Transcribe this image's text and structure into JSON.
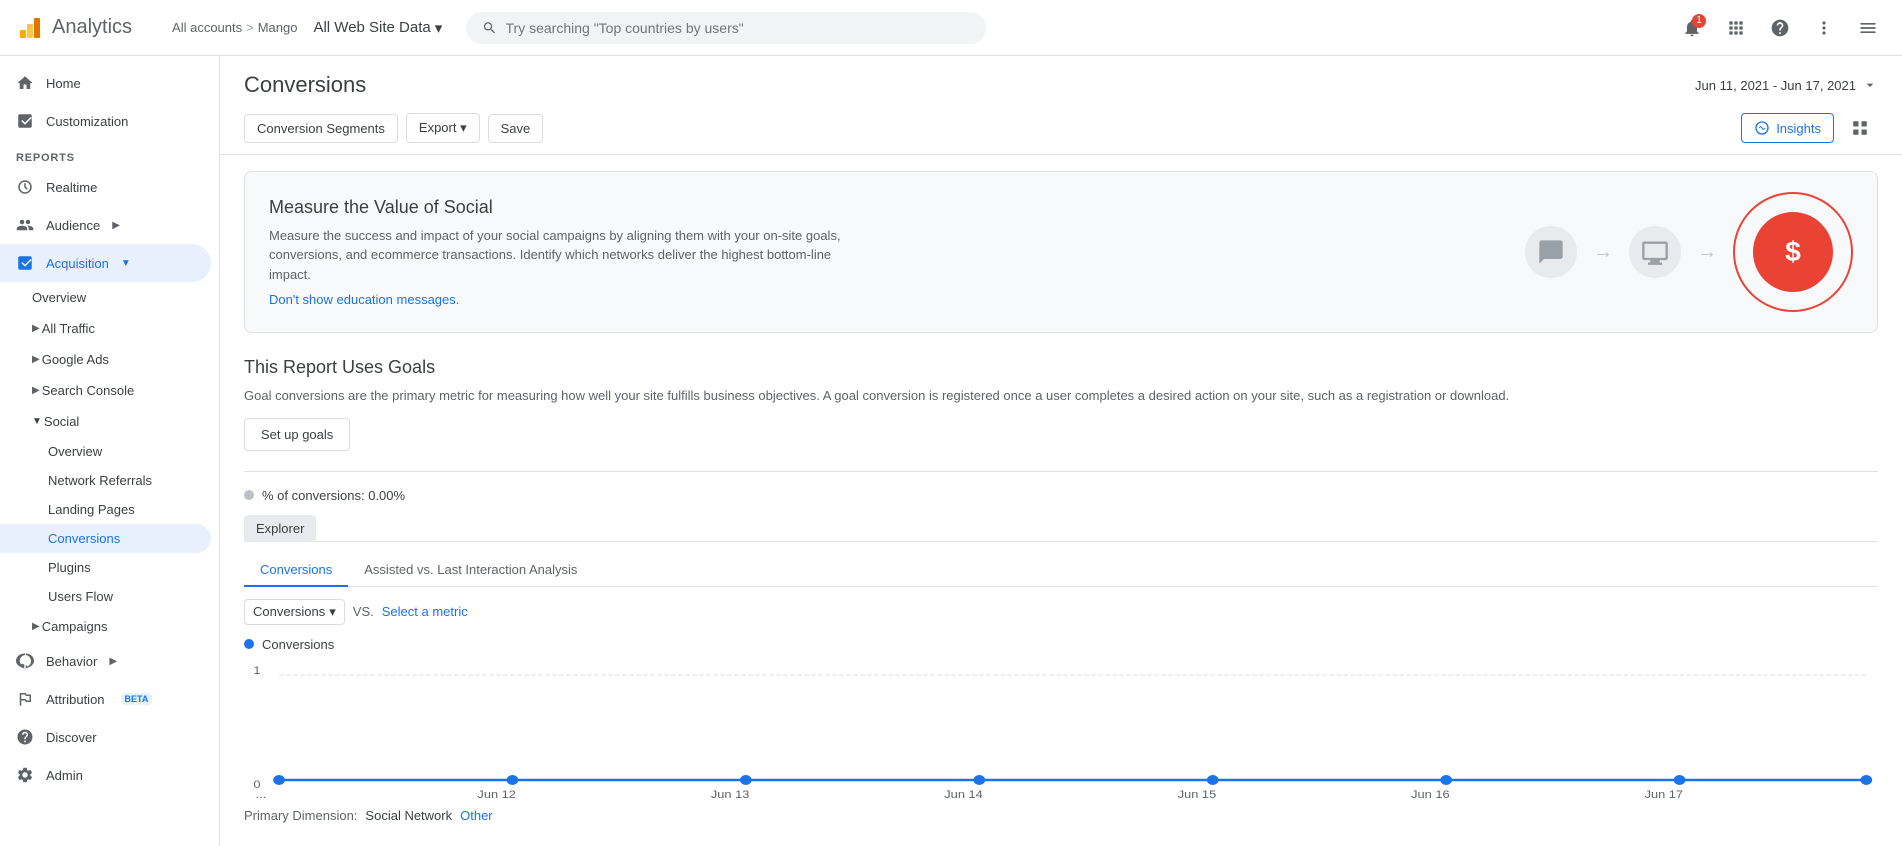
{
  "app": {
    "name": "Analytics",
    "logo_color": "#F9AB00"
  },
  "breadcrumb": {
    "all_accounts": "All accounts",
    "separator": ">",
    "account": "Mango"
  },
  "account_selector": {
    "label": "All Web Site Data",
    "dropdown_icon": "▾"
  },
  "search": {
    "placeholder": "Try searching \"Top countries by users\""
  },
  "topbar": {
    "notification_count": "1",
    "apps_icon": "⊞",
    "help_icon": "?",
    "more_icon": "⋮",
    "menu_icon": "☰"
  },
  "sidebar": {
    "home_label": "Home",
    "customization_label": "Customization",
    "reports_section": "REPORTS",
    "realtime_label": "Realtime",
    "audience_label": "Audience",
    "acquisition_label": "Acquisition",
    "acquisition_sub": {
      "overview": "Overview",
      "all_traffic": "All Traffic",
      "google_ads": "Google Ads",
      "search_console": "Search Console",
      "social": "Social",
      "social_sub": {
        "overview": "Overview",
        "network_referrals": "Network Referrals",
        "landing_pages": "Landing Pages",
        "conversions": "Conversions",
        "plugins": "Plugins",
        "users_flow": "Users Flow"
      },
      "campaigns": "Campaigns"
    },
    "behavior_label": "Behavior",
    "attribution_label": "Attribution",
    "attribution_beta": "BETA",
    "discover_label": "Discover",
    "admin_label": "Admin"
  },
  "main": {
    "page_title": "Conversions",
    "date_range": "Jun 11, 2021 - Jun 17, 2021",
    "toolbar": {
      "conversion_segments": "Conversion Segments",
      "export": "Export",
      "save": "Save"
    },
    "toolbar_right": {
      "insights": "Insights"
    },
    "edu_banner": {
      "title": "Measure the Value of Social",
      "description": "Measure the success and impact of your social campaigns by aligning them with your on-site goals, conversions, and ecommerce transactions. Identify which networks deliver the highest bottom-line impact.",
      "link": "Don't show education messages."
    },
    "goals_section": {
      "title": "This Report Uses Goals",
      "description": "Goal conversions are the primary metric for measuring how well your site fulfills business objectives. A goal conversion is registered once a user completes a desired action on your site, such as a registration or download.",
      "button": "Set up goals"
    },
    "metric": {
      "label": "% of conversions: 0.00%"
    },
    "explorer": {
      "label": "Explorer",
      "tabs": [
        {
          "label": "Conversions",
          "active": true
        },
        {
          "label": "Assisted vs. Last Interaction Analysis",
          "active": false
        }
      ]
    },
    "chart": {
      "metric_select": "Conversions",
      "vs_label": "VS.",
      "select_metric": "Select a metric",
      "legend": "Conversions",
      "y_labels": [
        "1",
        "0"
      ],
      "x_labels": [
        "...",
        "Jun 12",
        "Jun 13",
        "Jun 14",
        "Jun 15",
        "Jun 16",
        "Jun 17"
      ],
      "data_points": [
        0,
        0,
        0,
        0,
        0,
        0,
        0,
        0
      ]
    },
    "primary_dimension": {
      "label": "Primary Dimension:",
      "active": "Social Network",
      "other": "Other"
    }
  }
}
